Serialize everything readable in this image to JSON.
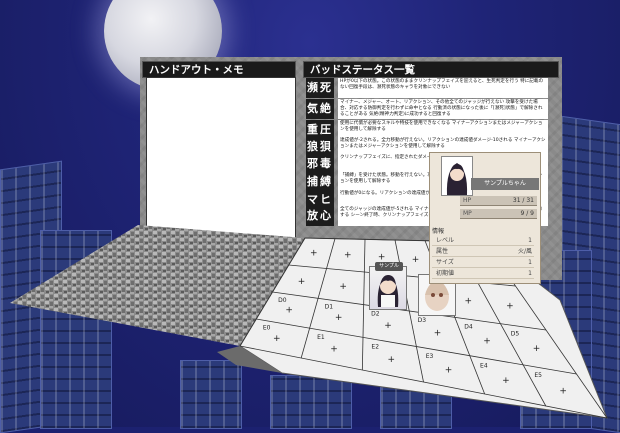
{
  "memo_panel": {
    "title": "ハンドアウト・メモ"
  },
  "status_panel": {
    "title": "バッドステータス一覧",
    "items": [
      {
        "name": "瀕死",
        "desc": "HPが0以下の状態。この状態のままクリンナップフェイズを迎えると、生死判定を行う 特に記載のない回復手段は、瀕死状態のキャラを対象にできない"
      },
      {
        "name": "気絶",
        "desc": "マイナー、メジャー、オート、リアクション、その他全てのジャッジが行えない 攻撃を受けた場合、対応する防御判定を行わずに命中となる 行動済の状態になった後に「[瀕死]状態」で解除されることがある 気絶(精神力判定)に成功すると回復する"
      },
      {
        "name": "重圧",
        "desc": "使用に代償が必要なスキルや特技を使用できなくなる マイナーアクションまたはメジャーアクションを使用して解除する"
      },
      {
        "name": "狼狽",
        "desc": "達成値が‐2される。全力移動が行えない。リアクションの達成値ダメージ‐10される マイナーアクションまたはメジャーアクションを使用して解除する"
      },
      {
        "name": "邪毒",
        "desc": "クリンナップフェイズに、指定されたダメージを受ける"
      },
      {
        "name": "捕縛",
        "desc": "「捕縛」を受けた状態。移動を行えない。攻撃を受けた場合 マイナーアクション、メジャーアクションを使用して解除する"
      },
      {
        "name": "マヒ",
        "desc": "行動値が0になる。リアクションの達成値が‐5される 解除にはマイナーアクションが必要"
      },
      {
        "name": "放心",
        "desc": "全てのジャッジの達成値が‐5される マイナーアクションまたはメジャーアクションを使用して解除する シーン終了時、クリンナップフェイズに自動的に回復する"
      }
    ]
  },
  "grid": {
    "row_labels": [
      "D0",
      "D1",
      "D2",
      "D3",
      "D4",
      "D5",
      "E0",
      "E1",
      "E2",
      "E3",
      "E4",
      "E5"
    ],
    "mark": "+"
  },
  "character_card": {
    "name": "サンプルちゃん",
    "hp_label": "HP",
    "hp_current": "31",
    "hp_max": "31",
    "mp_label": "MP",
    "mp_current": "9",
    "mp_max": "9",
    "info_title": "情報",
    "info": [
      {
        "key": "レベル",
        "value": "1"
      },
      {
        "key": "属性",
        "value": "火/風"
      },
      {
        "key": "サイズ",
        "value": "1"
      },
      {
        "key": "初期値",
        "value": "1"
      }
    ]
  },
  "token_tag": "サンプル",
  "colors": {
    "sky": "#1c2170",
    "panel_head": "#1a1a1a",
    "card_bg": "#ede6da"
  }
}
